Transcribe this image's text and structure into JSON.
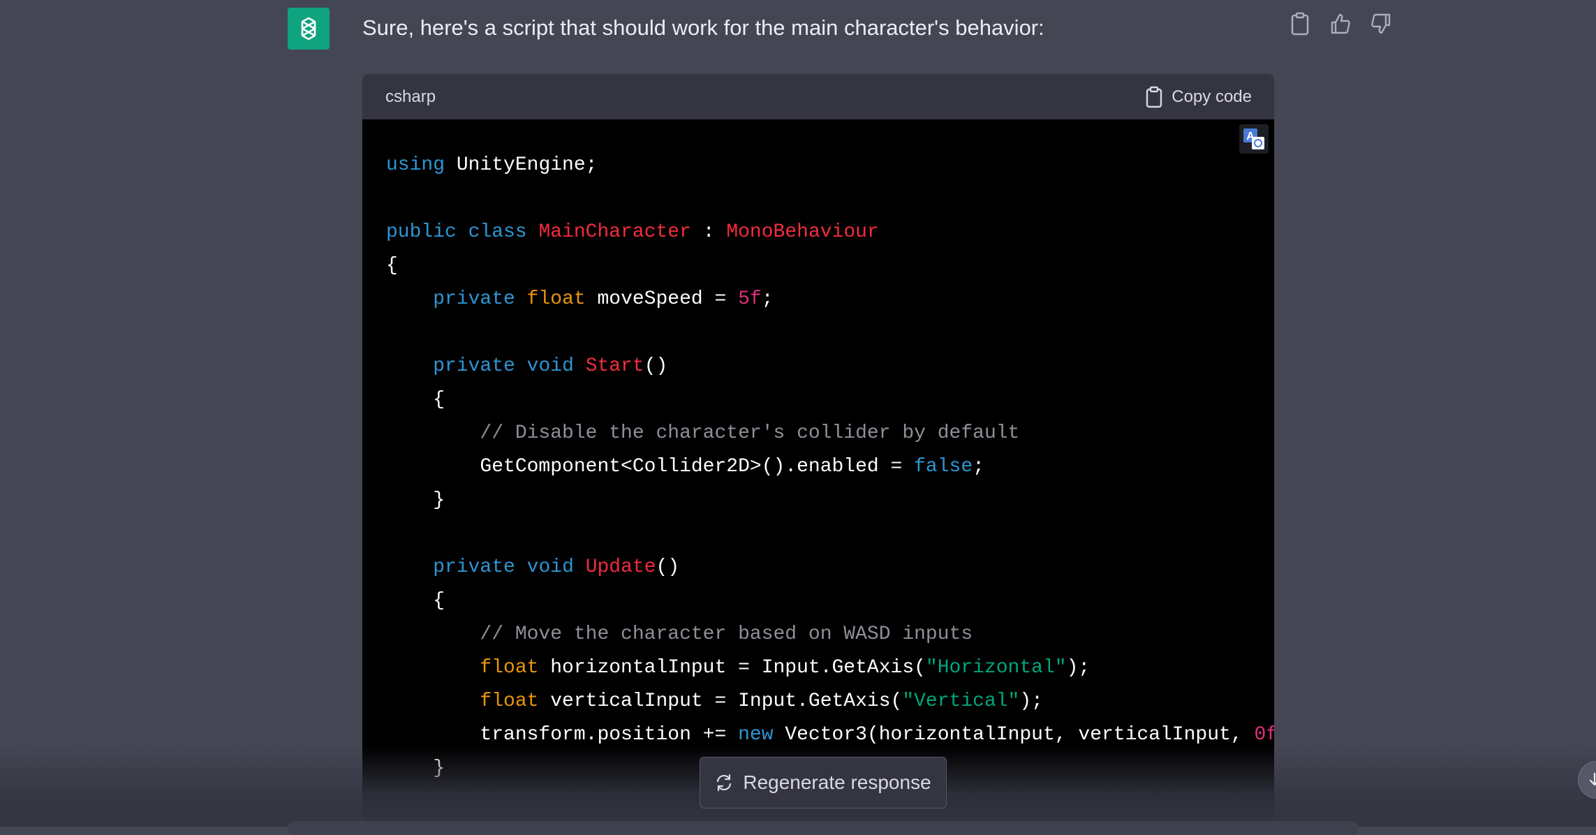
{
  "message": {
    "intro": "Sure, here's a script that should work for the main character's behavior:",
    "avatar_icon": "openai-logo-icon",
    "avatar_color": "#10a37f",
    "actions": [
      "clipboard-icon",
      "thumbs-up-icon",
      "thumbs-down-icon"
    ]
  },
  "code_block": {
    "language": "csharp",
    "copy_label": "Copy code",
    "colors": {
      "keyword": "#2e95d3",
      "type": "#e9950c",
      "class": "#f22c3d",
      "number": "#df3079",
      "string": "#00a67d",
      "comment": "#8f8f9a"
    },
    "lines": [
      [
        [
          "kw",
          "using"
        ],
        [
          "p",
          " UnityEngine;"
        ]
      ],
      [],
      [
        [
          "kw",
          "public"
        ],
        [
          "p",
          " "
        ],
        [
          "kw",
          "class"
        ],
        [
          "p",
          " "
        ],
        [
          "cl",
          "MainCharacter"
        ],
        [
          "p",
          " : "
        ],
        [
          "cl",
          "MonoBehaviour"
        ]
      ],
      [
        [
          "p",
          "{"
        ]
      ],
      [
        [
          "p",
          "    "
        ],
        [
          "kw",
          "private"
        ],
        [
          "p",
          " "
        ],
        [
          "ty",
          "float"
        ],
        [
          "p",
          " moveSpeed = "
        ],
        [
          "num",
          "5f"
        ],
        [
          "p",
          ";"
        ]
      ],
      [],
      [
        [
          "p",
          "    "
        ],
        [
          "kw",
          "private"
        ],
        [
          "p",
          " "
        ],
        [
          "kw",
          "void"
        ],
        [
          "p",
          " "
        ],
        [
          "cl",
          "Start"
        ],
        [
          "p",
          "()"
        ]
      ],
      [
        [
          "p",
          "    {"
        ]
      ],
      [
        [
          "p",
          "        "
        ],
        [
          "cm",
          "// Disable the character's collider by default"
        ]
      ],
      [
        [
          "p",
          "        GetComponent<Collider2D>().enabled = "
        ],
        [
          "kw",
          "false"
        ],
        [
          "p",
          ";"
        ]
      ],
      [
        [
          "p",
          "    }"
        ]
      ],
      [],
      [
        [
          "p",
          "    "
        ],
        [
          "kw",
          "private"
        ],
        [
          "p",
          " "
        ],
        [
          "kw",
          "void"
        ],
        [
          "p",
          " "
        ],
        [
          "cl",
          "Update"
        ],
        [
          "p",
          "()"
        ]
      ],
      [
        [
          "p",
          "    {"
        ]
      ],
      [
        [
          "p",
          "        "
        ],
        [
          "cm",
          "// Move the character based on WASD inputs"
        ]
      ],
      [
        [
          "p",
          "        "
        ],
        [
          "ty",
          "float"
        ],
        [
          "p",
          " horizontalInput = Input.GetAxis("
        ],
        [
          "str",
          "\"Horizontal\""
        ],
        [
          "p",
          ");"
        ]
      ],
      [
        [
          "p",
          "        "
        ],
        [
          "ty",
          "float"
        ],
        [
          "p",
          " verticalInput = Input.GetAxis("
        ],
        [
          "str",
          "\"Vertical\""
        ],
        [
          "p",
          ");"
        ]
      ],
      [
        [
          "p",
          "        transform.position += "
        ],
        [
          "kw",
          "new"
        ],
        [
          "p",
          " Vector3(horizontalInput, verticalInput, "
        ],
        [
          "num",
          "0f"
        ]
      ],
      [
        [
          "p",
          "    }"
        ]
      ]
    ]
  },
  "regenerate": {
    "label": "Regenerate response",
    "icon": "refresh-icon"
  },
  "scroll_icon": "arrow-down-icon"
}
